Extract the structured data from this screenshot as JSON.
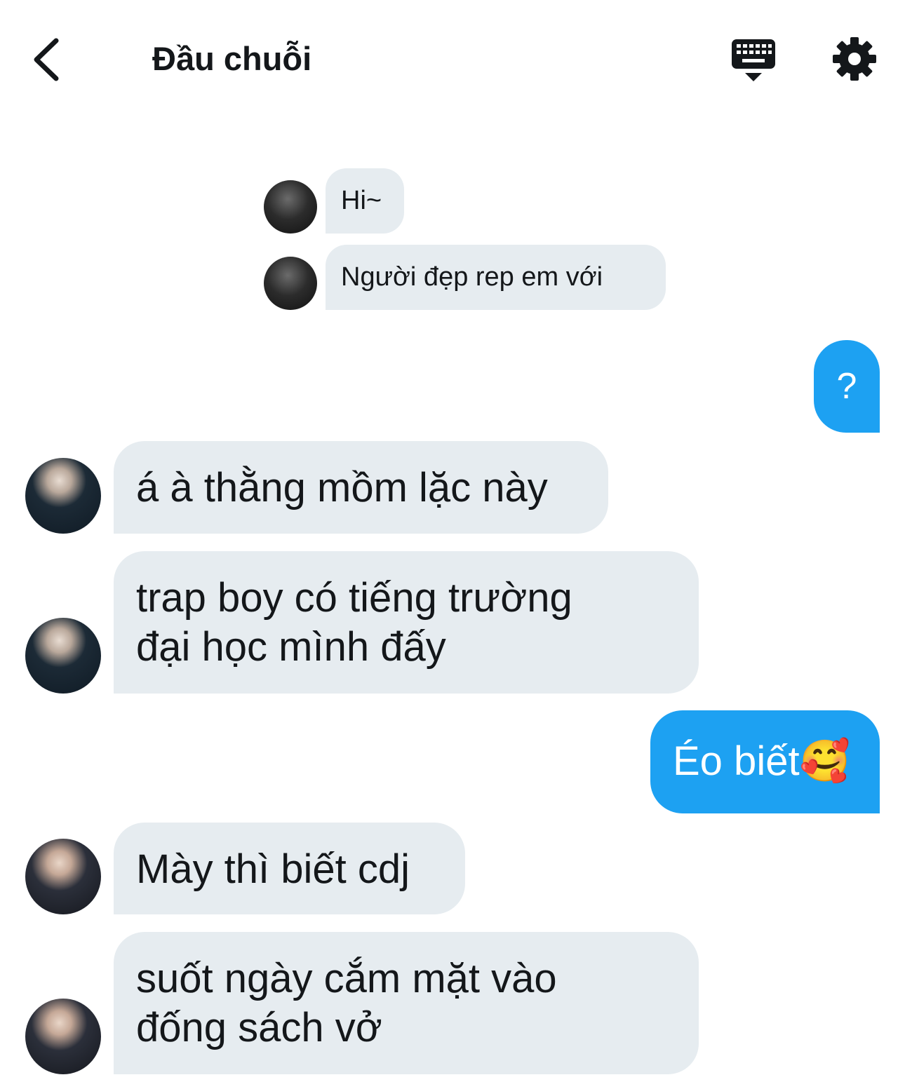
{
  "header": {
    "title": "Đầu chuỗi",
    "back_icon": "chevron-left-icon",
    "keyboard_icon": "keyboard-icon",
    "settings_icon": "gear-icon"
  },
  "colors": {
    "received_bubble": "#e6ecf0",
    "sent_bubble": "#1da1f2",
    "text": "#14171a"
  },
  "messages": [
    {
      "sender": "other",
      "text": "Hi~"
    },
    {
      "sender": "other",
      "text": "Người đẹp rep em với"
    },
    {
      "sender": "me",
      "text": "?"
    },
    {
      "sender": "other",
      "text": "á à thằng mồm lặc này"
    },
    {
      "sender": "other",
      "text": "trap boy có tiếng trường\nđại học mình đấy"
    },
    {
      "sender": "me",
      "text": "Éo biết🥰"
    },
    {
      "sender": "other",
      "text": "Mày thì biết cdj"
    },
    {
      "sender": "other",
      "text": "suốt ngày cắm mặt vào\nđống sách vở"
    }
  ]
}
